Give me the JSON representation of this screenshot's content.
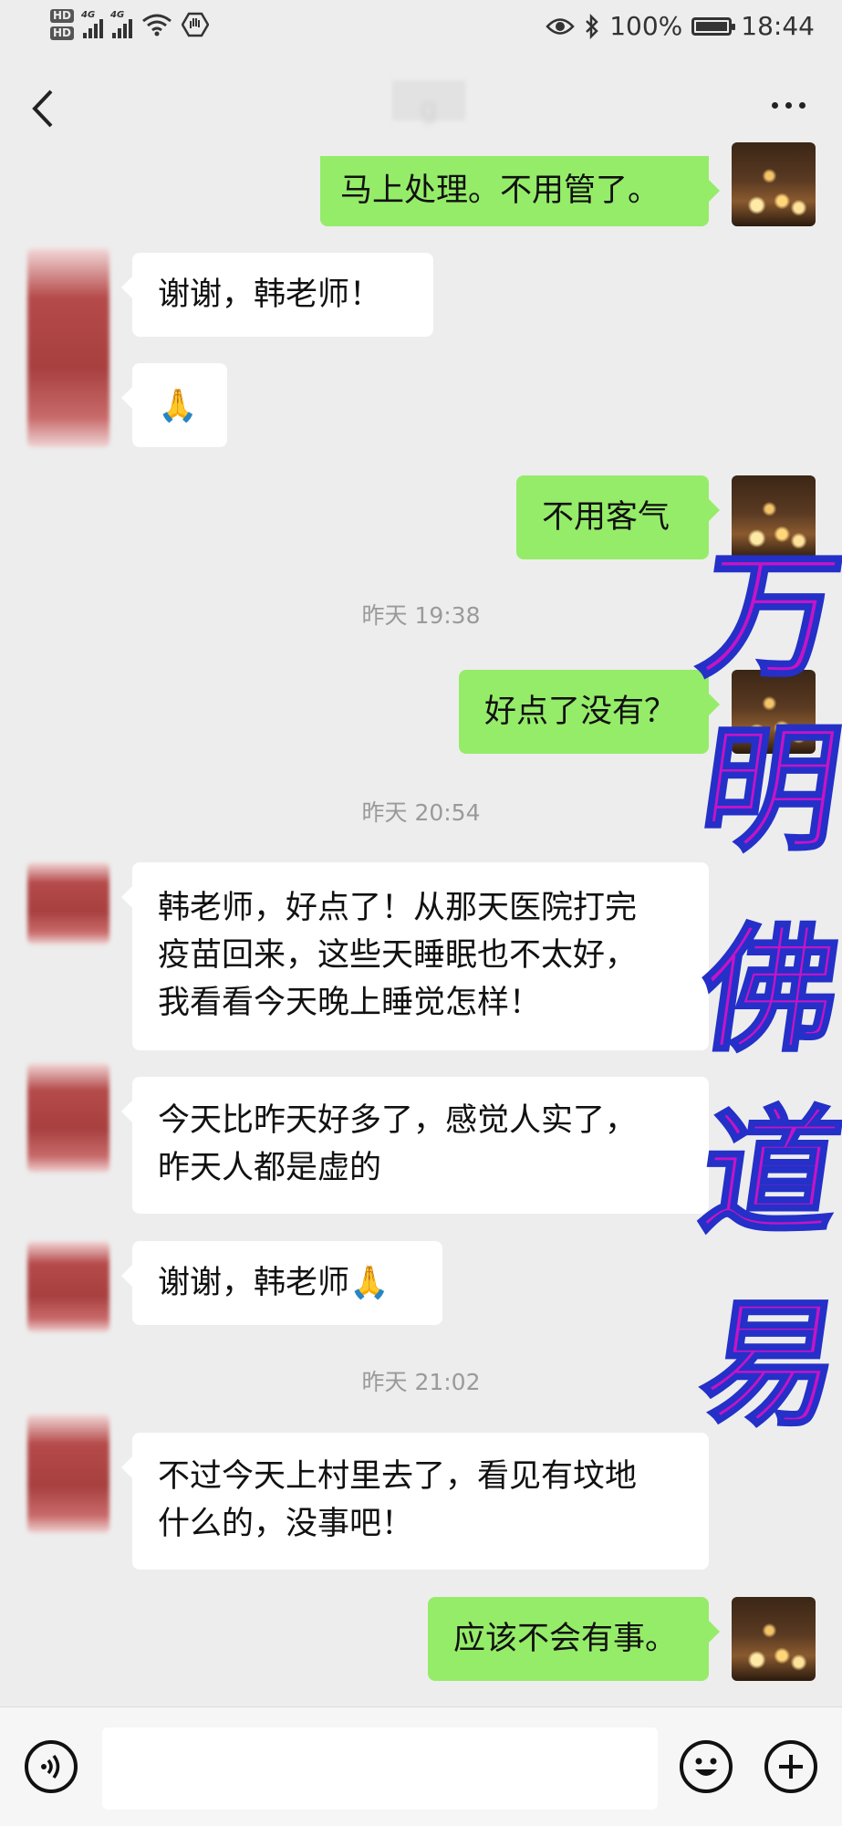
{
  "status_bar": {
    "hd1": "HD",
    "hd2": "HD",
    "net1": "4G",
    "net2": "4G",
    "battery": "100%",
    "time": "18:44"
  },
  "header": {
    "title_visible_fragment": "g"
  },
  "messages": [
    {
      "side": "me",
      "text": "马上处理。不用管了。"
    },
    {
      "side": "other",
      "text": "谢谢，韩老师！"
    },
    {
      "side": "other",
      "text": "🙏"
    },
    {
      "side": "me",
      "text": "不用客气"
    },
    {
      "type": "time",
      "text": "昨天 19:38"
    },
    {
      "side": "me",
      "text": "好点了没有？"
    },
    {
      "type": "time",
      "text": "昨天 20:54"
    },
    {
      "side": "other",
      "lines": [
        "韩老师，好点了！从那天医院打完",
        "疫苗回来，这些天睡眠也不太好，",
        "我看看今天晚上睡觉怎样！"
      ]
    },
    {
      "side": "other",
      "lines": [
        "今天比昨天好多了，感觉人实了，",
        "昨天人都是虚的"
      ]
    },
    {
      "side": "other",
      "text": "谢谢，韩老师🙏"
    },
    {
      "type": "time",
      "text": "昨天 21:02"
    },
    {
      "side": "other",
      "lines": [
        "不过今天上村里去了，看见有坟地",
        "什么的，没事吧！"
      ]
    },
    {
      "side": "me",
      "text": "应该不会有事。"
    }
  ],
  "watermark": [
    "万",
    "明",
    "佛",
    "道",
    "易"
  ],
  "colors": {
    "background": "#ededed",
    "my_bubble": "#95ec69",
    "other_bubble": "#ffffff",
    "timestamp": "#9a9a9a",
    "watermark_fill": "#c414c7",
    "watermark_outline": "#2430c8"
  },
  "icons": {
    "back": "chevron-left-icon",
    "more": "more-dots-icon",
    "voice": "voice-icon",
    "emoji": "smile-icon",
    "plus": "plus-icon"
  }
}
